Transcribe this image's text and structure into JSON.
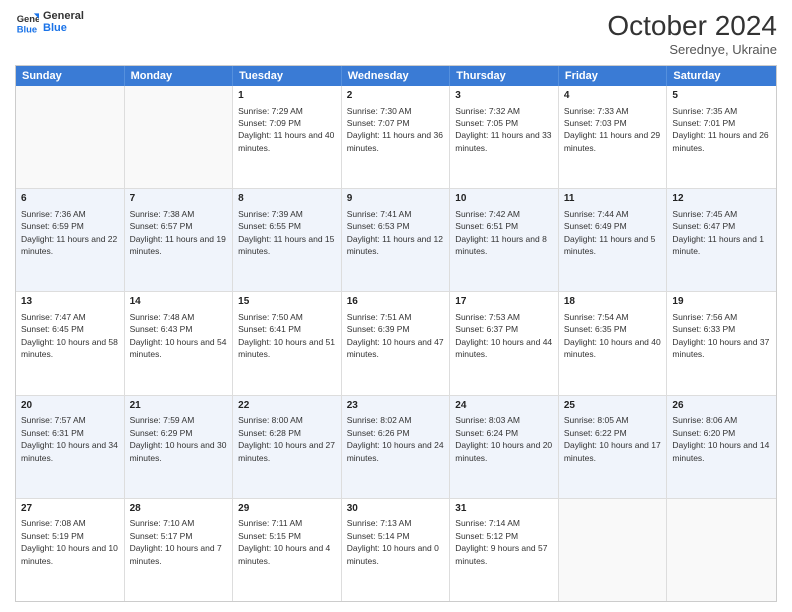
{
  "header": {
    "logo_line1": "General",
    "logo_line2": "Blue",
    "month": "October 2024",
    "location": "Serednye, Ukraine"
  },
  "weekdays": [
    "Sunday",
    "Monday",
    "Tuesday",
    "Wednesday",
    "Thursday",
    "Friday",
    "Saturday"
  ],
  "rows": [
    [
      {
        "day": "",
        "sunrise": "",
        "sunset": "",
        "daylight": "",
        "empty": true
      },
      {
        "day": "",
        "sunrise": "",
        "sunset": "",
        "daylight": "",
        "empty": true
      },
      {
        "day": "1",
        "sunrise": "Sunrise: 7:29 AM",
        "sunset": "Sunset: 7:09 PM",
        "daylight": "Daylight: 11 hours and 40 minutes."
      },
      {
        "day": "2",
        "sunrise": "Sunrise: 7:30 AM",
        "sunset": "Sunset: 7:07 PM",
        "daylight": "Daylight: 11 hours and 36 minutes."
      },
      {
        "day": "3",
        "sunrise": "Sunrise: 7:32 AM",
        "sunset": "Sunset: 7:05 PM",
        "daylight": "Daylight: 11 hours and 33 minutes."
      },
      {
        "day": "4",
        "sunrise": "Sunrise: 7:33 AM",
        "sunset": "Sunset: 7:03 PM",
        "daylight": "Daylight: 11 hours and 29 minutes."
      },
      {
        "day": "5",
        "sunrise": "Sunrise: 7:35 AM",
        "sunset": "Sunset: 7:01 PM",
        "daylight": "Daylight: 11 hours and 26 minutes."
      }
    ],
    [
      {
        "day": "6",
        "sunrise": "Sunrise: 7:36 AM",
        "sunset": "Sunset: 6:59 PM",
        "daylight": "Daylight: 11 hours and 22 minutes."
      },
      {
        "day": "7",
        "sunrise": "Sunrise: 7:38 AM",
        "sunset": "Sunset: 6:57 PM",
        "daylight": "Daylight: 11 hours and 19 minutes."
      },
      {
        "day": "8",
        "sunrise": "Sunrise: 7:39 AM",
        "sunset": "Sunset: 6:55 PM",
        "daylight": "Daylight: 11 hours and 15 minutes."
      },
      {
        "day": "9",
        "sunrise": "Sunrise: 7:41 AM",
        "sunset": "Sunset: 6:53 PM",
        "daylight": "Daylight: 11 hours and 12 minutes."
      },
      {
        "day": "10",
        "sunrise": "Sunrise: 7:42 AM",
        "sunset": "Sunset: 6:51 PM",
        "daylight": "Daylight: 11 hours and 8 minutes."
      },
      {
        "day": "11",
        "sunrise": "Sunrise: 7:44 AM",
        "sunset": "Sunset: 6:49 PM",
        "daylight": "Daylight: 11 hours and 5 minutes."
      },
      {
        "day": "12",
        "sunrise": "Sunrise: 7:45 AM",
        "sunset": "Sunset: 6:47 PM",
        "daylight": "Daylight: 11 hours and 1 minute."
      }
    ],
    [
      {
        "day": "13",
        "sunrise": "Sunrise: 7:47 AM",
        "sunset": "Sunset: 6:45 PM",
        "daylight": "Daylight: 10 hours and 58 minutes."
      },
      {
        "day": "14",
        "sunrise": "Sunrise: 7:48 AM",
        "sunset": "Sunset: 6:43 PM",
        "daylight": "Daylight: 10 hours and 54 minutes."
      },
      {
        "day": "15",
        "sunrise": "Sunrise: 7:50 AM",
        "sunset": "Sunset: 6:41 PM",
        "daylight": "Daylight: 10 hours and 51 minutes."
      },
      {
        "day": "16",
        "sunrise": "Sunrise: 7:51 AM",
        "sunset": "Sunset: 6:39 PM",
        "daylight": "Daylight: 10 hours and 47 minutes."
      },
      {
        "day": "17",
        "sunrise": "Sunrise: 7:53 AM",
        "sunset": "Sunset: 6:37 PM",
        "daylight": "Daylight: 10 hours and 44 minutes."
      },
      {
        "day": "18",
        "sunrise": "Sunrise: 7:54 AM",
        "sunset": "Sunset: 6:35 PM",
        "daylight": "Daylight: 10 hours and 40 minutes."
      },
      {
        "day": "19",
        "sunrise": "Sunrise: 7:56 AM",
        "sunset": "Sunset: 6:33 PM",
        "daylight": "Daylight: 10 hours and 37 minutes."
      }
    ],
    [
      {
        "day": "20",
        "sunrise": "Sunrise: 7:57 AM",
        "sunset": "Sunset: 6:31 PM",
        "daylight": "Daylight: 10 hours and 34 minutes."
      },
      {
        "day": "21",
        "sunrise": "Sunrise: 7:59 AM",
        "sunset": "Sunset: 6:29 PM",
        "daylight": "Daylight: 10 hours and 30 minutes."
      },
      {
        "day": "22",
        "sunrise": "Sunrise: 8:00 AM",
        "sunset": "Sunset: 6:28 PM",
        "daylight": "Daylight: 10 hours and 27 minutes."
      },
      {
        "day": "23",
        "sunrise": "Sunrise: 8:02 AM",
        "sunset": "Sunset: 6:26 PM",
        "daylight": "Daylight: 10 hours and 24 minutes."
      },
      {
        "day": "24",
        "sunrise": "Sunrise: 8:03 AM",
        "sunset": "Sunset: 6:24 PM",
        "daylight": "Daylight: 10 hours and 20 minutes."
      },
      {
        "day": "25",
        "sunrise": "Sunrise: 8:05 AM",
        "sunset": "Sunset: 6:22 PM",
        "daylight": "Daylight: 10 hours and 17 minutes."
      },
      {
        "day": "26",
        "sunrise": "Sunrise: 8:06 AM",
        "sunset": "Sunset: 6:20 PM",
        "daylight": "Daylight: 10 hours and 14 minutes."
      }
    ],
    [
      {
        "day": "27",
        "sunrise": "Sunrise: 7:08 AM",
        "sunset": "Sunset: 5:19 PM",
        "daylight": "Daylight: 10 hours and 10 minutes."
      },
      {
        "day": "28",
        "sunrise": "Sunrise: 7:10 AM",
        "sunset": "Sunset: 5:17 PM",
        "daylight": "Daylight: 10 hours and 7 minutes."
      },
      {
        "day": "29",
        "sunrise": "Sunrise: 7:11 AM",
        "sunset": "Sunset: 5:15 PM",
        "daylight": "Daylight: 10 hours and 4 minutes."
      },
      {
        "day": "30",
        "sunrise": "Sunrise: 7:13 AM",
        "sunset": "Sunset: 5:14 PM",
        "daylight": "Daylight: 10 hours and 0 minutes."
      },
      {
        "day": "31",
        "sunrise": "Sunrise: 7:14 AM",
        "sunset": "Sunset: 5:12 PM",
        "daylight": "Daylight: 9 hours and 57 minutes."
      },
      {
        "day": "",
        "sunrise": "",
        "sunset": "",
        "daylight": "",
        "empty": true
      },
      {
        "day": "",
        "sunrise": "",
        "sunset": "",
        "daylight": "",
        "empty": true
      }
    ]
  ]
}
